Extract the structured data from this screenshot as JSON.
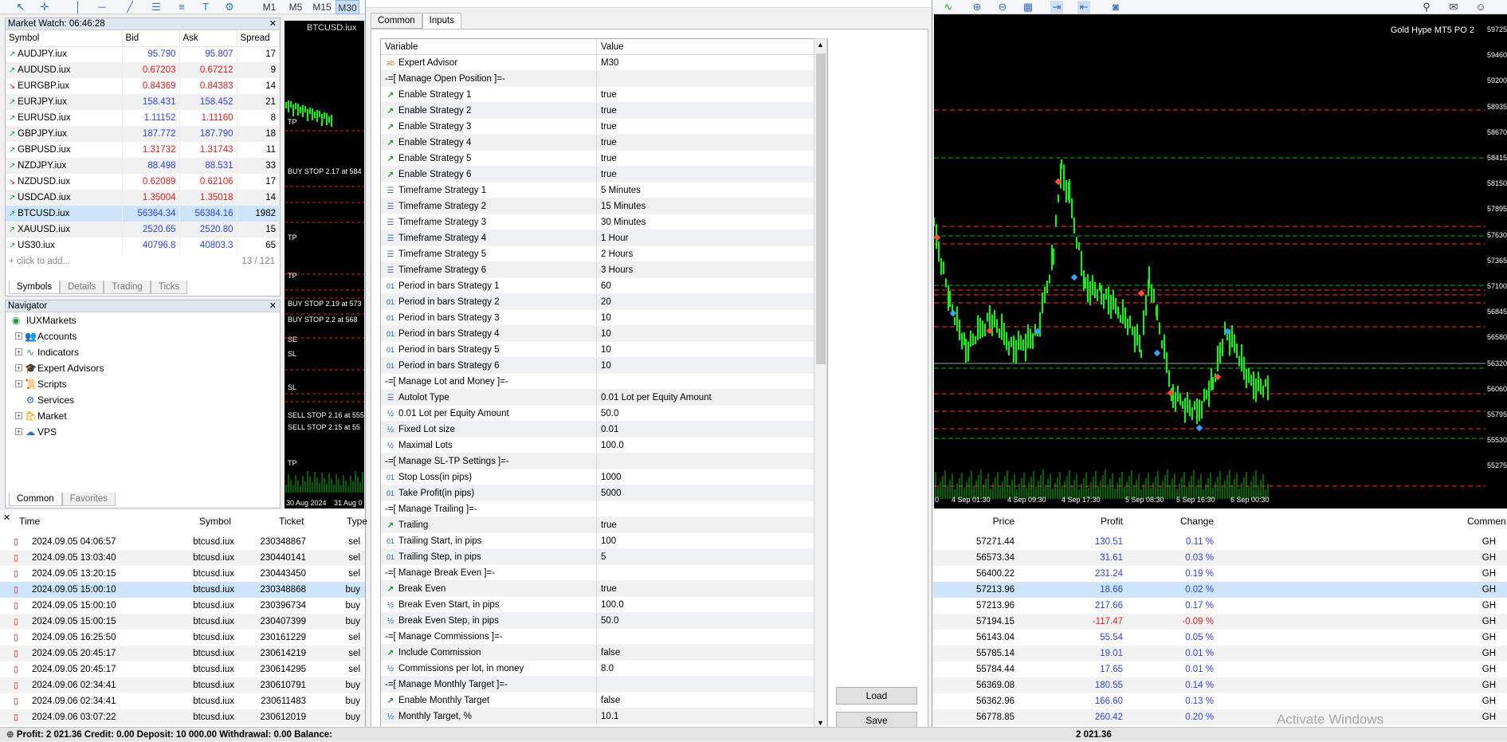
{
  "toolbar": {
    "timeframes": [
      "M1",
      "M5",
      "M15",
      "M30"
    ],
    "active_timeframe": "M30"
  },
  "market_watch": {
    "title": "Market Watch: 06:46:28",
    "columns": [
      "Symbol",
      "Bid",
      "Ask",
      "Spread"
    ],
    "rows": [
      {
        "symbol": "AUDJPY.iux",
        "bid": "95.790",
        "ask": "95.807",
        "spread": "17",
        "dir": "up",
        "color": "up"
      },
      {
        "symbol": "AUDUSD.iux",
        "bid": "0.67203",
        "ask": "0.67212",
        "spread": "9",
        "dir": "up",
        "color": "dn"
      },
      {
        "symbol": "EURGBP.iux",
        "bid": "0.84369",
        "ask": "0.84383",
        "spread": "14",
        "dir": "dn",
        "color": "dn"
      },
      {
        "symbol": "EURJPY.iux",
        "bid": "158.431",
        "ask": "158.452",
        "spread": "21",
        "dir": "up",
        "color": "up"
      },
      {
        "symbol": "EURUSD.iux",
        "bid": "1.11152",
        "ask": "1.11160",
        "spread": "8",
        "dir": "up",
        "color": "mix"
      },
      {
        "symbol": "GBPJPY.iux",
        "bid": "187.772",
        "ask": "187.790",
        "spread": "18",
        "dir": "up",
        "color": "up"
      },
      {
        "symbol": "GBPUSD.iux",
        "bid": "1.31732",
        "ask": "1.31743",
        "spread": "11",
        "dir": "up",
        "color": "dn"
      },
      {
        "symbol": "NZDJPY.iux",
        "bid": "88.498",
        "ask": "88.531",
        "spread": "33",
        "dir": "up",
        "color": "up"
      },
      {
        "symbol": "NZDUSD.iux",
        "bid": "0.62089",
        "ask": "0.62106",
        "spread": "17",
        "dir": "dn",
        "color": "dn"
      },
      {
        "symbol": "USDCAD.iux",
        "bid": "1.35004",
        "ask": "1.35018",
        "spread": "14",
        "dir": "up",
        "color": "dn"
      },
      {
        "symbol": "BTCUSD.iux",
        "bid": "56364.34",
        "ask": "56384.16",
        "spread": "1982",
        "dir": "up",
        "color": "up"
      },
      {
        "symbol": "XAUUSD.iux",
        "bid": "2520.65",
        "ask": "2520.80",
        "spread": "15",
        "dir": "up",
        "color": "up"
      },
      {
        "symbol": "US30.iux",
        "bid": "40796.8",
        "ask": "40803.3",
        "spread": "65",
        "dir": "up",
        "color": "up"
      }
    ],
    "add_label": "click to add...",
    "count": "13 / 121",
    "tabs": [
      "Symbols",
      "Details",
      "Trading",
      "Ticks"
    ]
  },
  "navigator": {
    "title": "Navigator",
    "root": "IUXMarkets",
    "items": [
      "Accounts",
      "Indicators",
      "Expert Advisors",
      "Scripts",
      "Services",
      "Market",
      "VPS"
    ],
    "tabs": [
      "Common",
      "Favorites"
    ]
  },
  "chart_left": {
    "title": "BTCUSD.iux",
    "labels": [
      "TP",
      "BUY STOP 2.17 at 584",
      "TP",
      "TP",
      "BUY STOP 2.19 at 573",
      "BUY STOP 2.2 at 568",
      "SE",
      "SL",
      "SL",
      "SELL STOP 2.16 at 555",
      "SELL STOP 2.15 at 55",
      "TP"
    ],
    "dates": [
      "30 Aug 2024",
      "31 Aug 0"
    ]
  },
  "dialog": {
    "tabs": [
      "Common",
      "Inputs"
    ],
    "headers": [
      "Variable",
      "Value"
    ],
    "rows": [
      {
        "i": "ab",
        "v": "Expert Advisor",
        "val": "M30"
      },
      {
        "i": "",
        "v": "-=[ Manage Open Position ]=-",
        "val": ""
      },
      {
        "i": "str",
        "v": "Enable Strategy 1",
        "val": "true"
      },
      {
        "i": "str",
        "v": "Enable Strategy 2",
        "val": "true"
      },
      {
        "i": "str",
        "v": "Enable Strategy 3",
        "val": "true"
      },
      {
        "i": "str",
        "v": "Enable Strategy 4",
        "val": "true"
      },
      {
        "i": "str",
        "v": "Enable Strategy 5",
        "val": "true"
      },
      {
        "i": "str",
        "v": "Enable Strategy 6",
        "val": "true"
      },
      {
        "i": "tf",
        "v": "Timeframe Strategy 1",
        "val": "5 Minutes"
      },
      {
        "i": "tf",
        "v": "Timeframe Strategy 2",
        "val": "15 Minutes"
      },
      {
        "i": "tf",
        "v": "Timeframe Strategy 3",
        "val": "30 Minutes"
      },
      {
        "i": "tf",
        "v": "Timeframe Strategy 4",
        "val": "1 Hour"
      },
      {
        "i": "tf",
        "v": "Timeframe Strategy 5",
        "val": "2 Hours"
      },
      {
        "i": "tf",
        "v": "Timeframe Strategy 6",
        "val": "3 Hours"
      },
      {
        "i": "int",
        "v": "Period in bars Strategy 1",
        "val": "60"
      },
      {
        "i": "int",
        "v": "Period in bars Strategy 2",
        "val": "20"
      },
      {
        "i": "int",
        "v": "Period in bars Strategy 3",
        "val": "10"
      },
      {
        "i": "int",
        "v": "Period in bars Strategy 4",
        "val": "10"
      },
      {
        "i": "int",
        "v": "Period in bars Strategy 5",
        "val": "10"
      },
      {
        "i": "int",
        "v": "Period in bars Strategy 6",
        "val": "10"
      },
      {
        "i": "",
        "v": "-=[ Manage Lot and Money ]=-",
        "val": ""
      },
      {
        "i": "tf",
        "v": "Autolot Type",
        "val": "0.01 Lot per Equity Amount"
      },
      {
        "i": "dbl",
        "v": "0.01 Lot per Equity Amount",
        "val": "50.0"
      },
      {
        "i": "dbl",
        "v": "Fixed Lot size",
        "val": "0.01"
      },
      {
        "i": "dbl",
        "v": "Maximal Lots",
        "val": "100.0"
      },
      {
        "i": "",
        "v": "-=[ Manage SL-TP Settings ]=-",
        "val": ""
      },
      {
        "i": "int",
        "v": "Stop Loss(in pips)",
        "val": "1000"
      },
      {
        "i": "int",
        "v": "Take Profit(in pips)",
        "val": "5000"
      },
      {
        "i": "",
        "v": "-=[ Manage Trailing ]=-",
        "val": ""
      },
      {
        "i": "str",
        "v": "Trailing",
        "val": "true"
      },
      {
        "i": "int",
        "v": "Trailing Start, in pips",
        "val": "100"
      },
      {
        "i": "int",
        "v": "Trailing Step, in pips",
        "val": "5"
      },
      {
        "i": "",
        "v": "-=[ Manage Break Even ]=-",
        "val": ""
      },
      {
        "i": "str",
        "v": "Break Even",
        "val": "true"
      },
      {
        "i": "dbl",
        "v": "Break Even Start, in pips",
        "val": "100.0"
      },
      {
        "i": "dbl",
        "v": "Break Even Step, in pips",
        "val": "50.0"
      },
      {
        "i": "",
        "v": "-=[ Manage Commissions ]=-",
        "val": ""
      },
      {
        "i": "str",
        "v": "Include Commission",
        "val": "false"
      },
      {
        "i": "dbl",
        "v": "Commissions per lot, in money",
        "val": "8.0"
      },
      {
        "i": "",
        "v": "-=[ Manage Monthly Target ]=-",
        "val": ""
      },
      {
        "i": "str",
        "v": "Enable Monthly Target",
        "val": "false"
      },
      {
        "i": "dbl",
        "v": "Monthly Target, %",
        "val": "10.1"
      }
    ],
    "load_label": "Load",
    "save_label": "Save"
  },
  "chart_right": {
    "title": "Gold Hype MT5 PO 2",
    "yaxis": [
      "59725",
      "59460",
      "59200",
      "58935",
      "58670",
      "58415",
      "58150",
      "57895",
      "57630",
      "57365",
      "57100",
      "56845",
      "56580",
      "56320",
      "56060",
      "55795",
      "55530",
      "55275"
    ],
    "xaxis": [
      "4 Sep 01:30",
      "4 Sep 09:30",
      "4 Sep 17:30",
      "5 Sep 08:30",
      "5 Sep 16:30",
      "6 Sep 00:30"
    ],
    "first_tick": "0"
  },
  "trades": {
    "headers": [
      "Time",
      "Symbol",
      "Ticket",
      "Type"
    ],
    "rows": [
      {
        "time": "2024.09.05 04:06:57",
        "symbol": "btcusd.iux",
        "ticket": "230348867",
        "type": "sel"
      },
      {
        "time": "2024.09.05 13:03:40",
        "symbol": "btcusd.iux",
        "ticket": "230440141",
        "type": "sel"
      },
      {
        "time": "2024.09.05 13:20:15",
        "symbol": "btcusd.iux",
        "ticket": "230443450",
        "type": "sel"
      },
      {
        "time": "2024.09.05 15:00:10",
        "symbol": "btcusd.iux",
        "ticket": "230348868",
        "type": "buy"
      },
      {
        "time": "2024.09.05 15:00:10",
        "symbol": "btcusd.iux",
        "ticket": "230396734",
        "type": "buy"
      },
      {
        "time": "2024.09.05 15:00:15",
        "symbol": "btcusd.iux",
        "ticket": "230407399",
        "type": "buy"
      },
      {
        "time": "2024.09.05 16:25:50",
        "symbol": "btcusd.iux",
        "ticket": "230161229",
        "type": "sel"
      },
      {
        "time": "2024.09.05 20:45:17",
        "symbol": "btcusd.iux",
        "ticket": "230614219",
        "type": "sel"
      },
      {
        "time": "2024.09.05 20:45:17",
        "symbol": "btcusd.iux",
        "ticket": "230614295",
        "type": "sel"
      },
      {
        "time": "2024.09.06 02:34:41",
        "symbol": "btcusd.iux",
        "ticket": "230610791",
        "type": "buy"
      },
      {
        "time": "2024.09.06 02:34:41",
        "symbol": "btcusd.iux",
        "ticket": "230611483",
        "type": "buy"
      },
      {
        "time": "2024.09.06 03:07:22",
        "symbol": "btcusd.iux",
        "ticket": "230612019",
        "type": "buy"
      }
    ],
    "right_headers": [
      "Price",
      "Profit",
      "Change",
      "Commen"
    ],
    "right_rows": [
      {
        "price": "57271.44",
        "profit": "130.51",
        "change": "0.11 %",
        "c": "GH"
      },
      {
        "price": "56573.34",
        "profit": "31.61",
        "change": "0.03 %",
        "c": "GH"
      },
      {
        "price": "56400.22",
        "profit": "231.24",
        "change": "0.19 %",
        "c": "GH"
      },
      {
        "price": "57213.96",
        "profit": "18.66",
        "change": "0.02 %",
        "c": "GH"
      },
      {
        "price": "57213.96",
        "profit": "217.66",
        "change": "0.17 %",
        "c": "GH"
      },
      {
        "price": "57194.15",
        "profit": "-117.47",
        "change": "-0.09 %",
        "c": "GH"
      },
      {
        "price": "56143.04",
        "profit": "55.54",
        "change": "0.05 %",
        "c": "GH"
      },
      {
        "price": "55785.14",
        "profit": "19.01",
        "change": "0.01 %",
        "c": "GH"
      },
      {
        "price": "55784.44",
        "profit": "17.65",
        "change": "0.01 %",
        "c": "GH"
      },
      {
        "price": "56369.08",
        "profit": "180.55",
        "change": "0.14 %",
        "c": "GH"
      },
      {
        "price": "56362.96",
        "profit": "166.60",
        "change": "0.13 %",
        "c": "GH"
      },
      {
        "price": "56778.85",
        "profit": "260.42",
        "change": "0.20 %",
        "c": "GH"
      }
    ],
    "total": "2 021.36"
  },
  "footer": {
    "summary": "Profit: 2 021.36  Credit: 0.00  Deposit: 10 000.00  Withdrawal: 0.00  Balance:"
  },
  "watermark": "Activate Windows",
  "colors": {
    "chart_bg": "#000000",
    "candle": "#00ff00",
    "grid_red": "#ff0000",
    "grid_green": "#00c000",
    "profit_pos": "#2f3eea",
    "profit_neg": "#e11b1b"
  }
}
